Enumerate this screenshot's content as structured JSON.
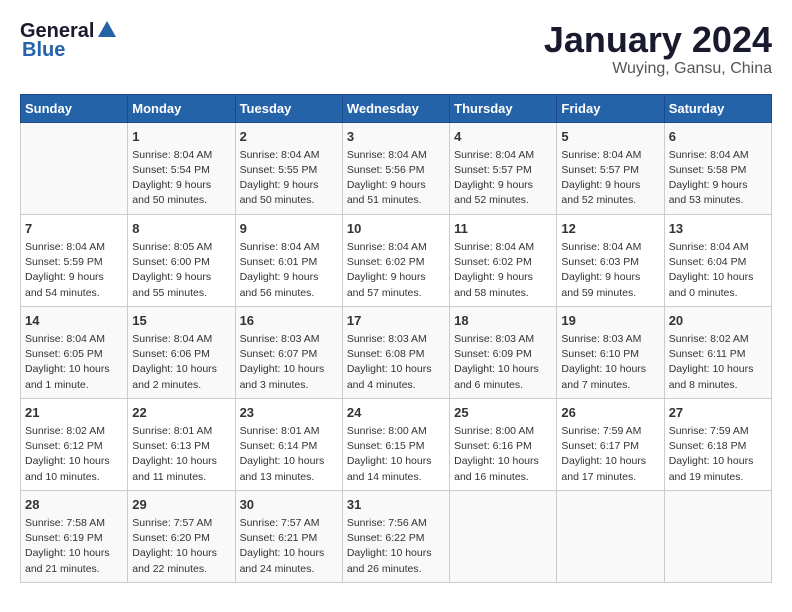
{
  "header": {
    "logo_general": "General",
    "logo_blue": "Blue",
    "title": "January 2024",
    "subtitle": "Wuying, Gansu, China"
  },
  "days_of_week": [
    "Sunday",
    "Monday",
    "Tuesday",
    "Wednesday",
    "Thursday",
    "Friday",
    "Saturday"
  ],
  "weeks": [
    [
      {
        "day": "",
        "info": ""
      },
      {
        "day": "1",
        "info": "Sunrise: 8:04 AM\nSunset: 5:54 PM\nDaylight: 9 hours\nand 50 minutes."
      },
      {
        "day": "2",
        "info": "Sunrise: 8:04 AM\nSunset: 5:55 PM\nDaylight: 9 hours\nand 50 minutes."
      },
      {
        "day": "3",
        "info": "Sunrise: 8:04 AM\nSunset: 5:56 PM\nDaylight: 9 hours\nand 51 minutes."
      },
      {
        "day": "4",
        "info": "Sunrise: 8:04 AM\nSunset: 5:57 PM\nDaylight: 9 hours\nand 52 minutes."
      },
      {
        "day": "5",
        "info": "Sunrise: 8:04 AM\nSunset: 5:57 PM\nDaylight: 9 hours\nand 52 minutes."
      },
      {
        "day": "6",
        "info": "Sunrise: 8:04 AM\nSunset: 5:58 PM\nDaylight: 9 hours\nand 53 minutes."
      }
    ],
    [
      {
        "day": "7",
        "info": "Sunrise: 8:04 AM\nSunset: 5:59 PM\nDaylight: 9 hours\nand 54 minutes."
      },
      {
        "day": "8",
        "info": "Sunrise: 8:05 AM\nSunset: 6:00 PM\nDaylight: 9 hours\nand 55 minutes."
      },
      {
        "day": "9",
        "info": "Sunrise: 8:04 AM\nSunset: 6:01 PM\nDaylight: 9 hours\nand 56 minutes."
      },
      {
        "day": "10",
        "info": "Sunrise: 8:04 AM\nSunset: 6:02 PM\nDaylight: 9 hours\nand 57 minutes."
      },
      {
        "day": "11",
        "info": "Sunrise: 8:04 AM\nSunset: 6:02 PM\nDaylight: 9 hours\nand 58 minutes."
      },
      {
        "day": "12",
        "info": "Sunrise: 8:04 AM\nSunset: 6:03 PM\nDaylight: 9 hours\nand 59 minutes."
      },
      {
        "day": "13",
        "info": "Sunrise: 8:04 AM\nSunset: 6:04 PM\nDaylight: 10 hours\nand 0 minutes."
      }
    ],
    [
      {
        "day": "14",
        "info": "Sunrise: 8:04 AM\nSunset: 6:05 PM\nDaylight: 10 hours\nand 1 minute."
      },
      {
        "day": "15",
        "info": "Sunrise: 8:04 AM\nSunset: 6:06 PM\nDaylight: 10 hours\nand 2 minutes."
      },
      {
        "day": "16",
        "info": "Sunrise: 8:03 AM\nSunset: 6:07 PM\nDaylight: 10 hours\nand 3 minutes."
      },
      {
        "day": "17",
        "info": "Sunrise: 8:03 AM\nSunset: 6:08 PM\nDaylight: 10 hours\nand 4 minutes."
      },
      {
        "day": "18",
        "info": "Sunrise: 8:03 AM\nSunset: 6:09 PM\nDaylight: 10 hours\nand 6 minutes."
      },
      {
        "day": "19",
        "info": "Sunrise: 8:03 AM\nSunset: 6:10 PM\nDaylight: 10 hours\nand 7 minutes."
      },
      {
        "day": "20",
        "info": "Sunrise: 8:02 AM\nSunset: 6:11 PM\nDaylight: 10 hours\nand 8 minutes."
      }
    ],
    [
      {
        "day": "21",
        "info": "Sunrise: 8:02 AM\nSunset: 6:12 PM\nDaylight: 10 hours\nand 10 minutes."
      },
      {
        "day": "22",
        "info": "Sunrise: 8:01 AM\nSunset: 6:13 PM\nDaylight: 10 hours\nand 11 minutes."
      },
      {
        "day": "23",
        "info": "Sunrise: 8:01 AM\nSunset: 6:14 PM\nDaylight: 10 hours\nand 13 minutes."
      },
      {
        "day": "24",
        "info": "Sunrise: 8:00 AM\nSunset: 6:15 PM\nDaylight: 10 hours\nand 14 minutes."
      },
      {
        "day": "25",
        "info": "Sunrise: 8:00 AM\nSunset: 6:16 PM\nDaylight: 10 hours\nand 16 minutes."
      },
      {
        "day": "26",
        "info": "Sunrise: 7:59 AM\nSunset: 6:17 PM\nDaylight: 10 hours\nand 17 minutes."
      },
      {
        "day": "27",
        "info": "Sunrise: 7:59 AM\nSunset: 6:18 PM\nDaylight: 10 hours\nand 19 minutes."
      }
    ],
    [
      {
        "day": "28",
        "info": "Sunrise: 7:58 AM\nSunset: 6:19 PM\nDaylight: 10 hours\nand 21 minutes."
      },
      {
        "day": "29",
        "info": "Sunrise: 7:57 AM\nSunset: 6:20 PM\nDaylight: 10 hours\nand 22 minutes."
      },
      {
        "day": "30",
        "info": "Sunrise: 7:57 AM\nSunset: 6:21 PM\nDaylight: 10 hours\nand 24 minutes."
      },
      {
        "day": "31",
        "info": "Sunrise: 7:56 AM\nSunset: 6:22 PM\nDaylight: 10 hours\nand 26 minutes."
      },
      {
        "day": "",
        "info": ""
      },
      {
        "day": "",
        "info": ""
      },
      {
        "day": "",
        "info": ""
      }
    ]
  ]
}
